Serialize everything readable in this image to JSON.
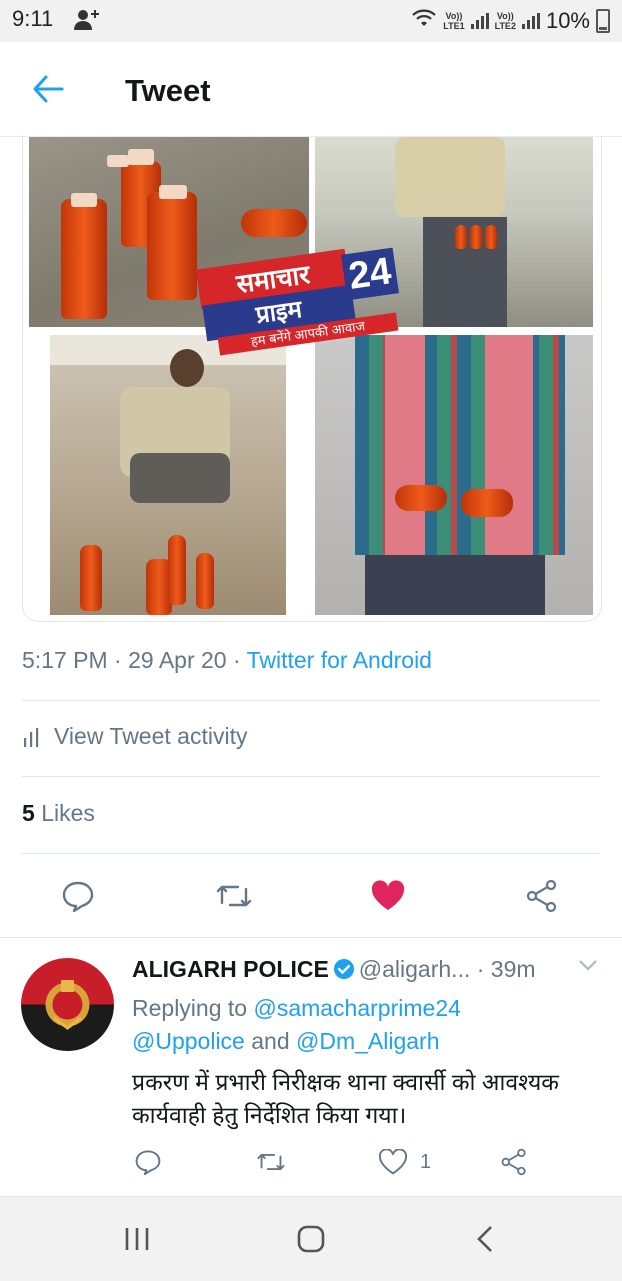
{
  "status_bar": {
    "time": "9:11",
    "lte1": [
      "Vo))",
      "LTE1"
    ],
    "lte2": [
      "Vo))",
      "LTE2"
    ],
    "battery": "10%"
  },
  "header": {
    "title": "Tweet"
  },
  "media": {
    "watermark_top": "समाचार",
    "watermark_num": "24",
    "watermark_bottom": "प्राइम",
    "watermark_tag": "हम बनेंगे आपकी आवाज"
  },
  "tweet": {
    "time": "5:17 PM",
    "date": "29 Apr 20",
    "source": "Twitter for Android",
    "activity_label": "View Tweet activity",
    "likes_count": "5",
    "likes_label": "Likes",
    "liked": true
  },
  "reply": {
    "name": "ALIGARH POLICE",
    "handle": "@aligarh...",
    "time": "· 39m",
    "replying_prefix": "Replying to",
    "mention1": "@samacharprime24",
    "mention2": "@Uppolice",
    "and_text": "and",
    "mention3": "@Dm_Aligarh",
    "text": "प्रकरण में प्रभारी निरीक्षक थाना क्वार्सी को आवश्यक कार्यवाही हेतु निर्देशित किया गया।",
    "likes": "1"
  },
  "colors": {
    "accent": "#1da1f2",
    "like": "#e0245e",
    "muted": "#657786"
  }
}
